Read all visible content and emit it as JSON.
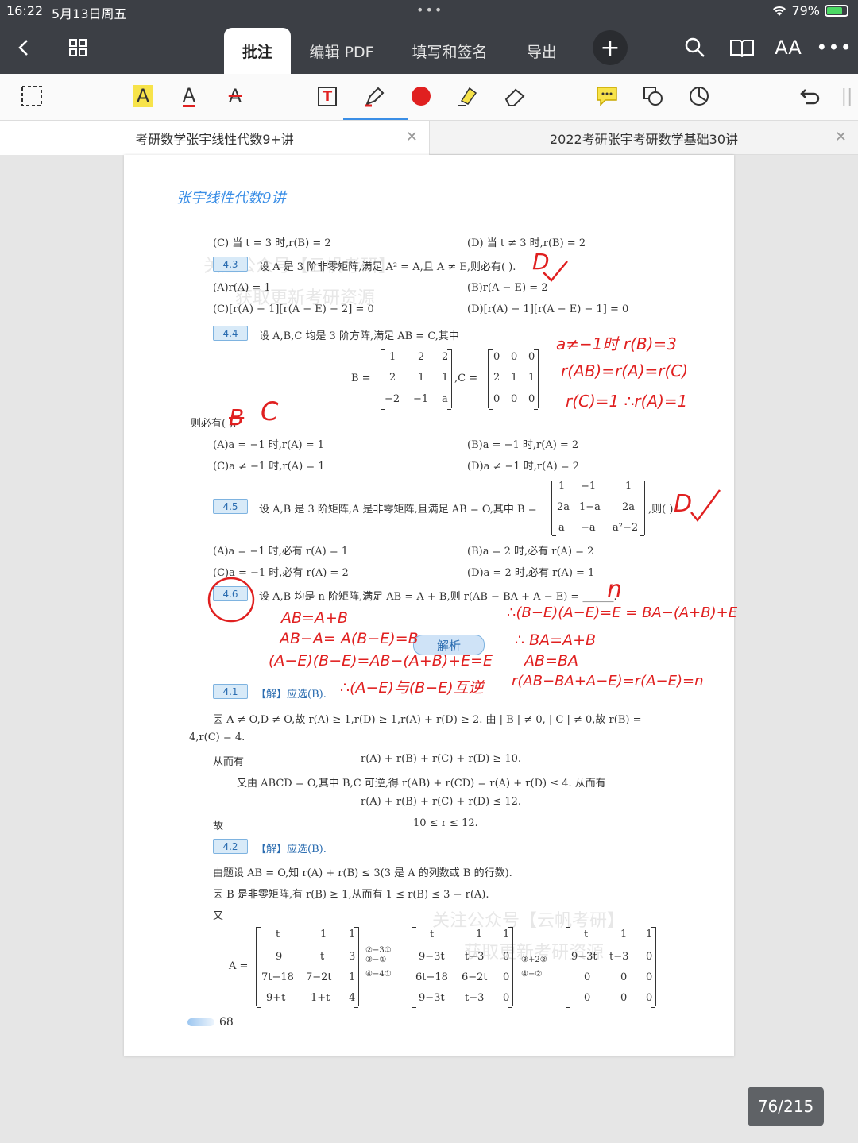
{
  "status": {
    "time": "16:22",
    "date": "5月13日周五",
    "battery": "79%",
    "battery_level": 0.79
  },
  "nav": {
    "tabs": [
      "批注",
      "编辑 PDF",
      "填写和签名",
      "导出"
    ],
    "icons": [
      "back-icon",
      "grid-icon",
      "plus-icon",
      "search-icon",
      "book-icon",
      "text-size-icon",
      "more-icon"
    ],
    "text_size_label": "AA"
  },
  "toolbar": {
    "letter": "A",
    "text_box": "T",
    "ink_color": "#e02020"
  },
  "doctabs": [
    {
      "title": "考研数学张宇线性代数9+讲"
    },
    {
      "title": "2022考研张宇考研数学基础30讲"
    }
  ],
  "page": {
    "logo": "张宇线性代数9讲",
    "watermarks": [
      "关注公众号【云帆考研】",
      "获取更新考研资源",
      "关注公众号【云帆考研】",
      "获取更新考研资源"
    ],
    "lines": [
      "(C) 当 t = 3 时,r(B) = 2",
      "(D) 当 t ≠ 3 时,r(B) = 2",
      "4.3",
      "设 A 是 3 阶非零矩阵,满足 A² = A,且 A ≠ E,则必有(   ).",
      "(A)r(A) = 1",
      "(B)r(A − E) = 2",
      "(C)[r(A) − 1][r(A − E) − 2] = 0",
      "(D)[r(A) − 1][r(A − E) − 1] = 0",
      "4.4",
      "设 A,B,C 均是 3 阶方阵,满足 AB = C,其中",
      "B =",
      ",C =",
      "则必有(   ).",
      "(A)a = −1 时,r(A) = 1",
      "(B)a = −1 时,r(A) = 2",
      "(C)a ≠ −1 时,r(A) = 1",
      "(D)a ≠ −1 时,r(A) = 2",
      "4.5",
      "设 A,B 是 3 阶矩阵,A 是非零矩阵,且满足 AB = O,其中 B =",
      ",则(   ).",
      "(A)a = −1 时,必有 r(A) = 1",
      "(B)a = 2 时,必有 r(A) = 2",
      "(C)a = −1 时,必有 r(A) = 2",
      "(D)a = 2 时,必有 r(A) = 1",
      "4.6",
      "设 A,B 均是 n 阶矩阵,满足 AB = A + B,则 r(AB − BA + A − E) = ______.",
      "解析",
      "4.1",
      "【解】应选(B).",
      "因 A ≠ O,D ≠ O,故 r(A) ≥ 1,r(D) ≥ 1,r(A) + r(D) ≥ 2. 由 | B | ≠ 0, | C | ≠ 0,故 r(B) =",
      "4,r(C) = 4.",
      "从而有",
      "r(A) + r(B) + r(C) + r(D) ≥ 10.",
      "又由 ABCD = O,其中 B,C 可逆,得 r(AB) + r(CD) = r(A) + r(D) ≤ 4. 从而有",
      "r(A) + r(B) + r(C) + r(D) ≤ 12.",
      "故",
      "10 ≤ r ≤ 12.",
      "4.2",
      "【解】应选(B).",
      "由题设 AB = O,知 r(A) + r(B) ≤ 3(3 是 A 的列数或 B 的行数).",
      "因 B 是非零矩阵,有 r(B) ≥ 1,从而有 1 ≤ r(B) ≤ 3 − r(A).",
      "又",
      "A =",
      "68"
    ],
    "matrix_B_44": [
      "1",
      "2",
      "2",
      "2",
      "1",
      "1",
      "−2",
      "−1",
      "a"
    ],
    "matrix_C_44": [
      "0",
      "0",
      "0",
      "2",
      "1",
      "1",
      "0",
      "0",
      "0"
    ],
    "matrix_B_45": [
      "1",
      "−1",
      "1",
      "2a",
      "1−a",
      "2a",
      "a",
      "−a",
      "a²−2"
    ],
    "matrix_A1": [
      "t",
      "1",
      "1",
      "9",
      "t",
      "3",
      "7t−18",
      "7−2t",
      "1",
      "9+t",
      "1+t",
      "4"
    ],
    "matrix_A2": [
      "t",
      "1",
      "1",
      "9−3t",
      "t−3",
      "0",
      "6t−18",
      "6−2t",
      "0",
      "9−3t",
      "t−3",
      "0"
    ],
    "matrix_A3": [
      "t",
      "1",
      "1",
      "9−3t",
      "t−3",
      "0",
      "0",
      "0",
      "0",
      "0",
      "0",
      "0"
    ],
    "ops1": [
      "②−3①",
      "③−①",
      "④−4①"
    ],
    "ops2": [
      "③+2②",
      "④−②"
    ],
    "handwriting": [
      "D",
      "a≠−1时  r(B)=3",
      "r(AB)=r(A)=r(C)",
      "r(C)=1  ∴r(A)=1",
      "B",
      "C",
      "D",
      "n",
      "AB=A+B",
      "AB−A= A(B−E)=B",
      "(A−E)(B−E)=AB−(A+B)+E=E",
      "∴(A−E)与(B−E)互逆",
      "∴(B−E)(A−E)=E = BA−(A+B)+E",
      "∴ BA=A+B",
      "AB=BA",
      "r(AB−BA+A−E)=r(A−E)=n"
    ]
  },
  "page_indicator": "76/215"
}
